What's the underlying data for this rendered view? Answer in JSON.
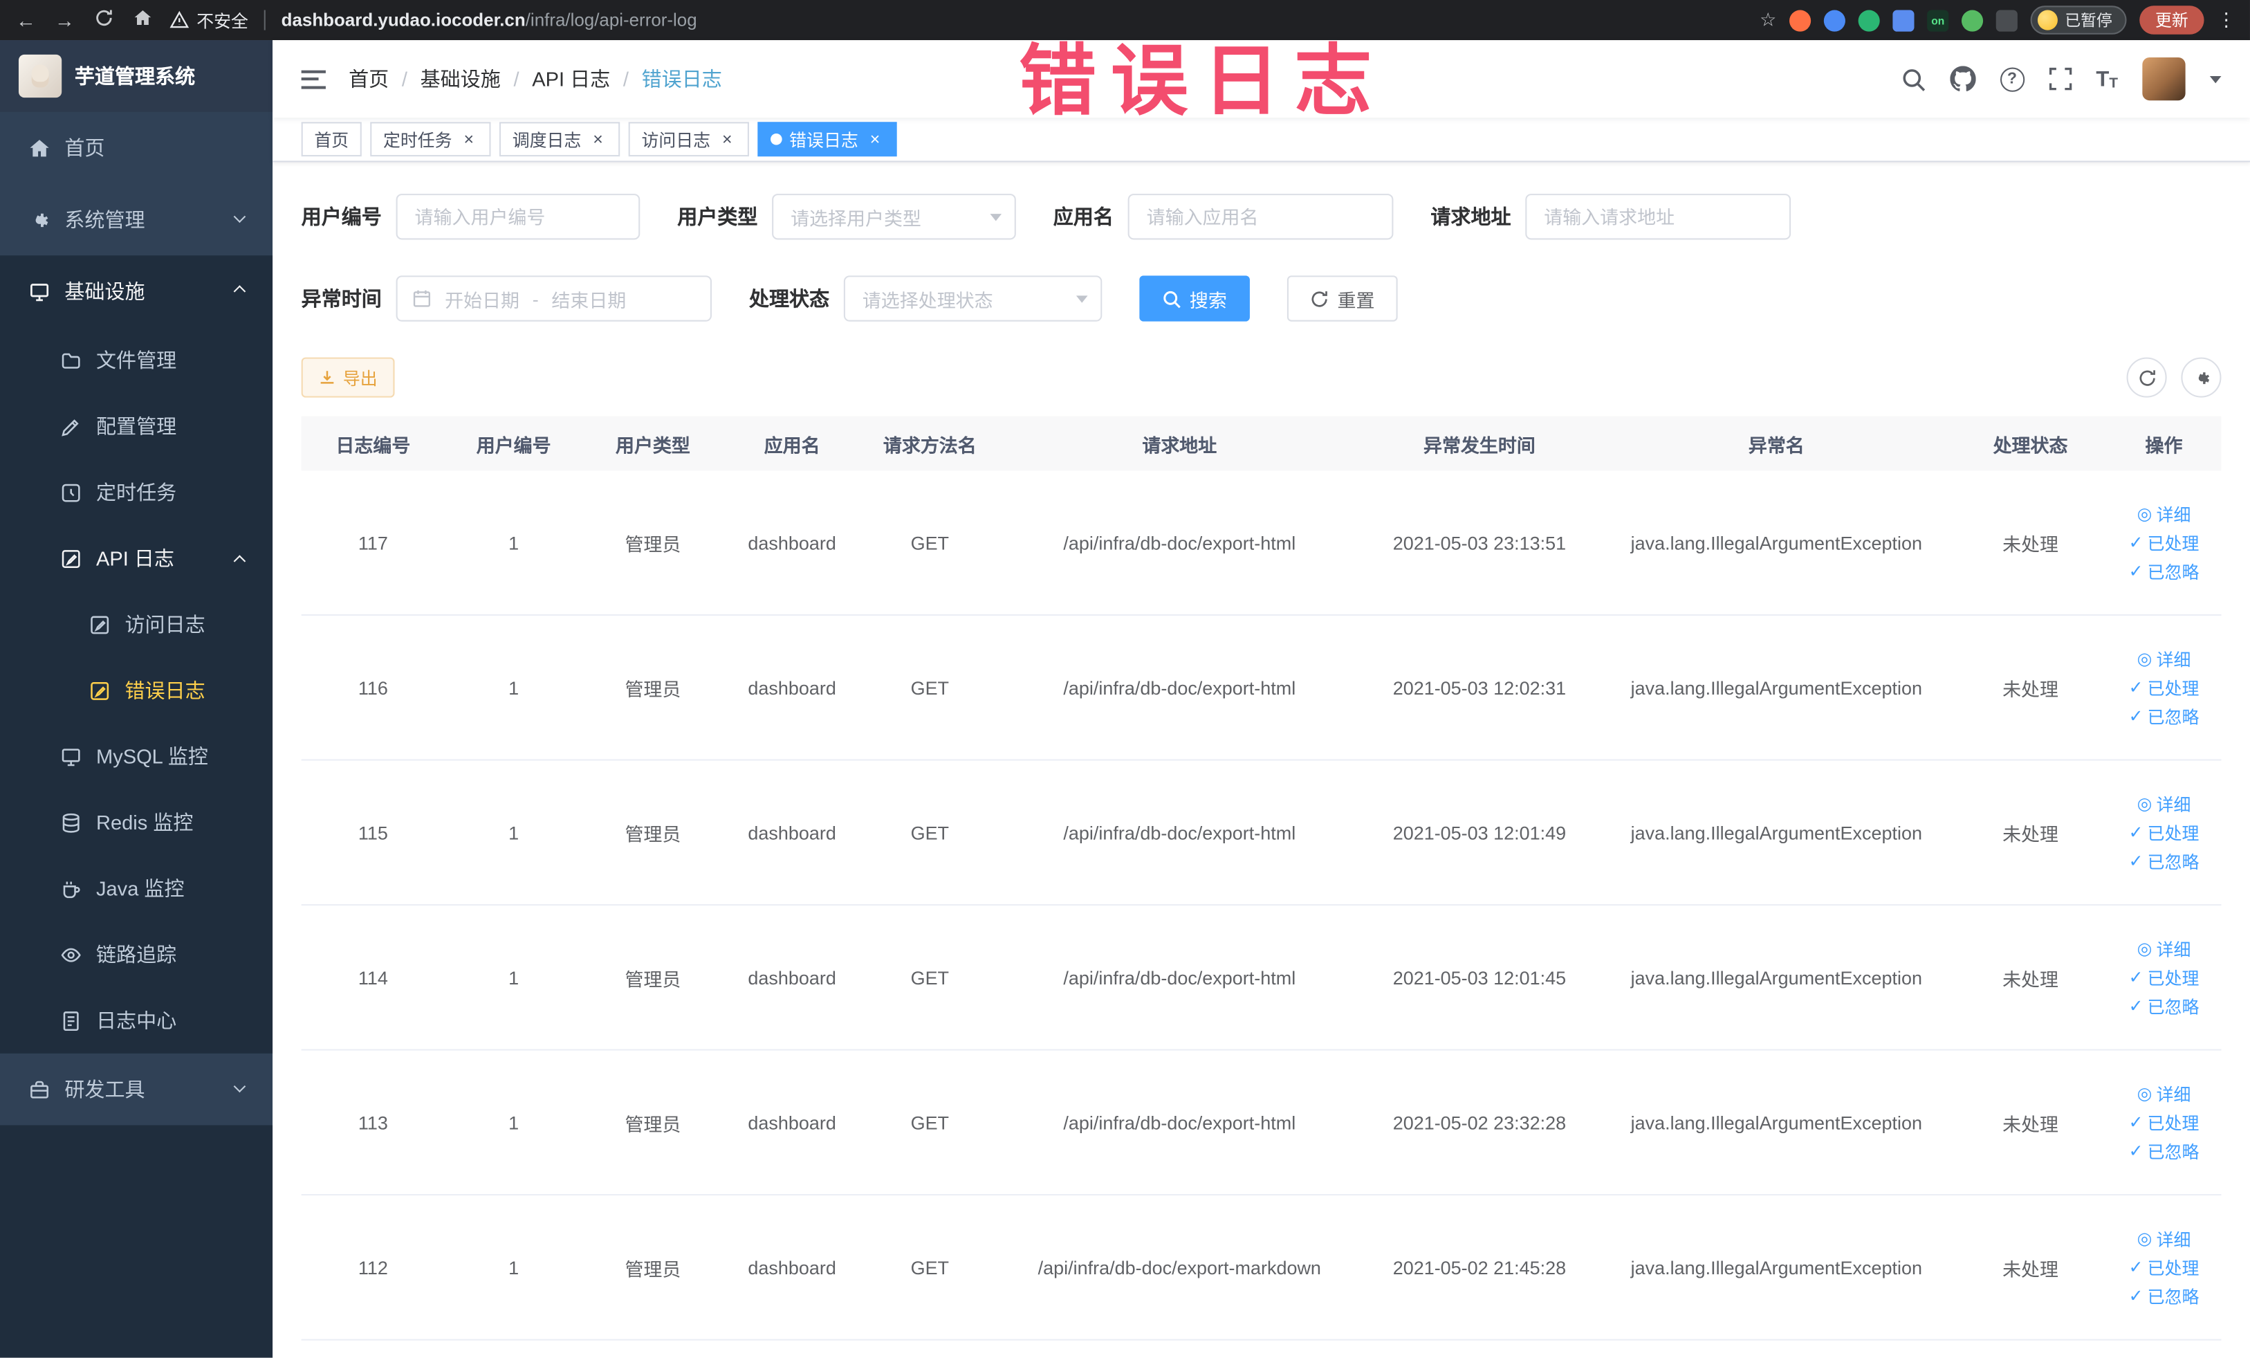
{
  "browser": {
    "security": "不安全",
    "url_domain": "dashboard.yudao.iocoder.cn",
    "url_path": "/infra/log/api-error-log",
    "extension_on_badge": "on",
    "paused_chip": "已暂停",
    "update_button": "更新"
  },
  "annotation": "错误日志",
  "sidebar": {
    "logo_title": "芋道管理系统",
    "items": {
      "home": "首页",
      "system": "系统管理",
      "infra": "基础设施",
      "file": "文件管理",
      "config": "配置管理",
      "job": "定时任务",
      "api_log": "API 日志",
      "access_log": "访问日志",
      "error_log": "错误日志",
      "mysql": "MySQL 监控",
      "redis": "Redis 监控",
      "java": "Java 监控",
      "trace": "链路追踪",
      "log_center": "日志中心",
      "dev_tools": "研发工具"
    }
  },
  "header": {
    "breadcrumb": [
      "首页",
      "基础设施",
      "API 日志",
      "错误日志"
    ],
    "breadcrumb_separator": "/"
  },
  "tabs": [
    {
      "label": "首页"
    },
    {
      "label": "定时任务"
    },
    {
      "label": "调度日志"
    },
    {
      "label": "访问日志"
    },
    {
      "label": "错误日志"
    }
  ],
  "filters": {
    "user_id_label": "用户编号",
    "user_id_placeholder": "请输入用户编号",
    "user_type_label": "用户类型",
    "user_type_placeholder": "请选择用户类型",
    "app_name_label": "应用名",
    "app_name_placeholder": "请输入应用名",
    "request_url_label": "请求地址",
    "request_url_placeholder": "请输入请求地址",
    "exception_time_label": "异常时间",
    "date_start_placeholder": "开始日期",
    "date_separator": "-",
    "date_end_placeholder": "结束日期",
    "process_status_label": "处理状态",
    "process_status_placeholder": "请选择处理状态",
    "search_button": "搜索",
    "reset_button": "重置"
  },
  "toolbar": {
    "export_button": "导出"
  },
  "table": {
    "columns": [
      "日志编号",
      "用户编号",
      "用户类型",
      "应用名",
      "请求方法名",
      "请求地址",
      "异常发生时间",
      "异常名",
      "处理状态",
      "操作"
    ],
    "row_actions": {
      "detail": "详细",
      "process": "已处理",
      "ignore": "已忽略"
    },
    "rows": [
      {
        "log_id": "117",
        "user_id": "1",
        "user_type": "管理员",
        "app_name": "dashboard",
        "method": "GET",
        "url": "/api/infra/db-doc/export-html",
        "time": "2021-05-03 23:13:51",
        "exception": "java.lang.IllegalArgumentException",
        "status": "未处理"
      },
      {
        "log_id": "116",
        "user_id": "1",
        "user_type": "管理员",
        "app_name": "dashboard",
        "method": "GET",
        "url": "/api/infra/db-doc/export-html",
        "time": "2021-05-03 12:02:31",
        "exception": "java.lang.IllegalArgumentException",
        "status": "未处理"
      },
      {
        "log_id": "115",
        "user_id": "1",
        "user_type": "管理员",
        "app_name": "dashboard",
        "method": "GET",
        "url": "/api/infra/db-doc/export-html",
        "time": "2021-05-03 12:01:49",
        "exception": "java.lang.IllegalArgumentException",
        "status": "未处理"
      },
      {
        "log_id": "114",
        "user_id": "1",
        "user_type": "管理员",
        "app_name": "dashboard",
        "method": "GET",
        "url": "/api/infra/db-doc/export-html",
        "time": "2021-05-03 12:01:45",
        "exception": "java.lang.IllegalArgumentException",
        "status": "未处理"
      },
      {
        "log_id": "113",
        "user_id": "1",
        "user_type": "管理员",
        "app_name": "dashboard",
        "method": "GET",
        "url": "/api/infra/db-doc/export-html",
        "time": "2021-05-02 23:32:28",
        "exception": "java.lang.IllegalArgumentException",
        "status": "未处理"
      },
      {
        "log_id": "112",
        "user_id": "1",
        "user_type": "管理员",
        "app_name": "dashboard",
        "method": "GET",
        "url": "/api/infra/db-doc/export-markdown",
        "time": "2021-05-02 21:45:28",
        "exception": "java.lang.IllegalArgumentException",
        "status": "未处理"
      }
    ]
  },
  "colors": {
    "primary": "#409eff",
    "warning": "#e6a23c",
    "sidebar_bg": "#304156",
    "submenu_bg": "#1f2d3d",
    "active_menu_text": "#ffd04b",
    "annotation_red": "#f23a5f"
  }
}
